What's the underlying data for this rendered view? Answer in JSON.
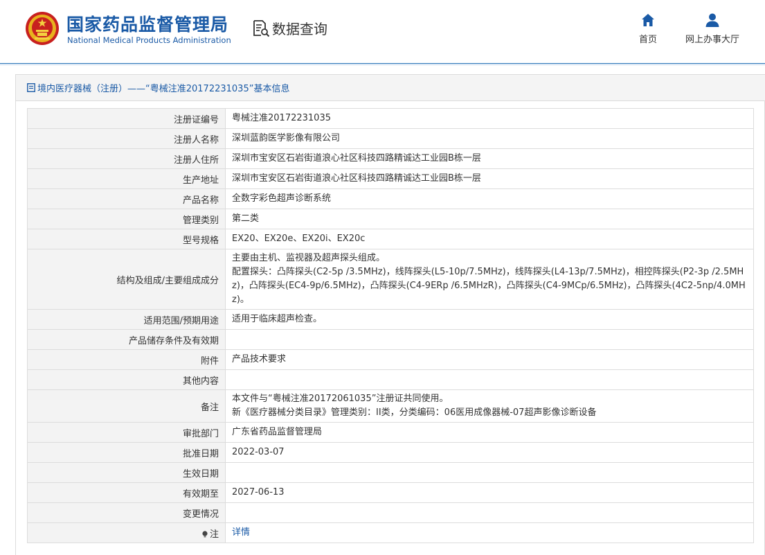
{
  "header": {
    "agency_cn": "国家药品监督管理局",
    "agency_en": "National Medical Products Administration",
    "query_title": "数据查询",
    "nav": [
      {
        "label": "首页",
        "icon": "home-icon"
      },
      {
        "label": "网上办事大厅",
        "icon": "user-icon"
      }
    ]
  },
  "colors": {
    "brand_blue": "#1a5aa6",
    "label_bg": "#f3f3f3",
    "border": "#dcdcdc"
  },
  "breadcrumb": "境内医疗器械（注册）——“粤械注准20172231035”基本信息",
  "rows": [
    {
      "label": "注册证编号",
      "value": "粤械注准20172231035"
    },
    {
      "label": "注册人名称",
      "value": "深圳蓝韵医学影像有限公司"
    },
    {
      "label": "注册人住所",
      "value": "深圳市宝安区石岩街道浪心社区科技四路精诚达工业园B栋一层"
    },
    {
      "label": "生产地址",
      "value": "深圳市宝安区石岩街道浪心社区科技四路精诚达工业园B栋一层"
    },
    {
      "label": "产品名称",
      "value": "全数字彩色超声诊断系统"
    },
    {
      "label": "管理类别",
      "value": "第二类"
    },
    {
      "label": "型号规格",
      "value": "EX20、EX20e、EX20i、EX20c"
    },
    {
      "label": "结构及组成/主要组成成分",
      "value_lines": [
        "主要由主机、监视器及超声探头组成。",
        "配置探头：凸阵探头(C2-5p /3.5MHz)，线阵探头(L5-10p/7.5MHz)，线阵探头(L4-13p/7.5MHz)，相控阵探头(P2-3p /2.5MHz)，凸阵探头(EC4-9p/6.5MHz)，凸阵探头(C4-9ERp /6.5MHzR)，凸阵探头(C4-9MCp/6.5MHz)，凸阵探头(4C2-5np/4.0MHz)。"
      ]
    },
    {
      "label": "适用范围/预期用途",
      "value": "适用于临床超声检查。"
    },
    {
      "label": "产品储存条件及有效期",
      "value": ""
    },
    {
      "label": "附件",
      "value": "产品技术要求"
    },
    {
      "label": "其他内容",
      "value": ""
    },
    {
      "label": "备注",
      "value_lines": [
        "本文件与“粤械注准20172061035”注册证共同使用。",
        "新《医疗器械分类目录》管理类别：II类，分类编码：06医用成像器械-07超声影像诊断设备"
      ]
    },
    {
      "label": "审批部门",
      "value": "广东省药品监督管理局"
    },
    {
      "label": "批准日期",
      "value": "2022-03-07"
    },
    {
      "label": "生效日期",
      "value": ""
    },
    {
      "label": "有效期至",
      "value": "2027-06-13"
    },
    {
      "label": "变更情况",
      "value": ""
    }
  ],
  "note_row": {
    "label": "注",
    "link": "详情"
  }
}
